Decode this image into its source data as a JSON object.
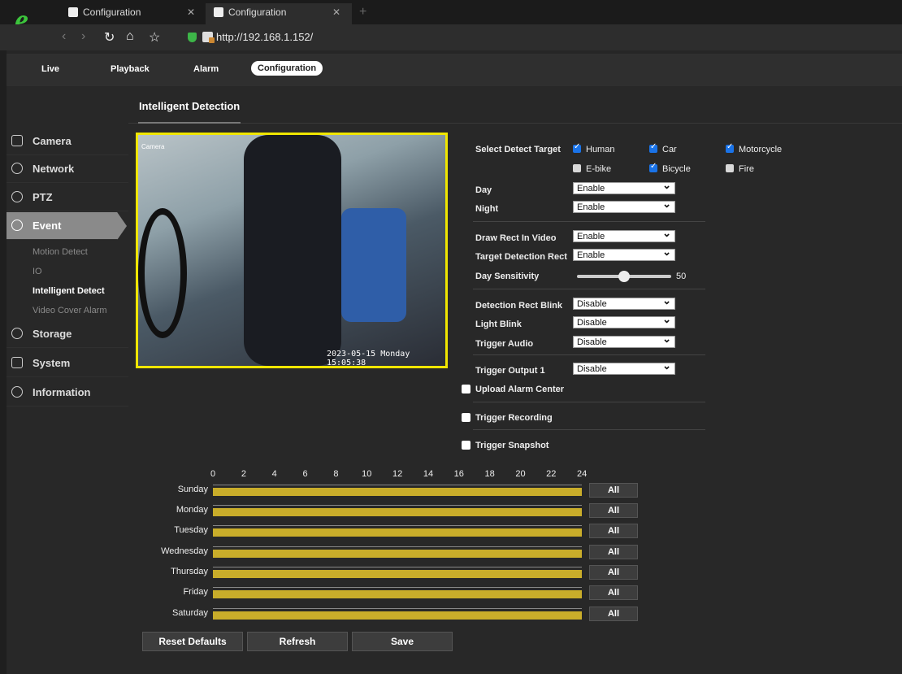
{
  "browser": {
    "tabs": [
      {
        "label": "Configuration"
      },
      {
        "label": "Configuration"
      }
    ],
    "url": "http://192.168.1.152/"
  },
  "topnav": {
    "items": [
      "Live",
      "Playback",
      "Alarm",
      "Configuration"
    ],
    "active": "Configuration"
  },
  "sidebar": {
    "items": [
      "Camera",
      "Network",
      "PTZ",
      "Event",
      "Storage",
      "System",
      "Information"
    ],
    "event_sub": [
      "Motion Detect",
      "IO",
      "Intelligent Detect",
      "Video Cover Alarm"
    ],
    "active_sub": "Intelligent Detect"
  },
  "page": {
    "title": "Intelligent Detection"
  },
  "video": {
    "camera_label": "Camera",
    "timestamp": "2023-05-15 Monday 15:05:38"
  },
  "form": {
    "detect_target_label": "Select Detect Target",
    "targets": [
      {
        "label": "Human",
        "checked": true
      },
      {
        "label": "Car",
        "checked": true
      },
      {
        "label": "Motorcycle",
        "checked": true
      },
      {
        "label": "E-bike",
        "checked": false
      },
      {
        "label": "Bicycle",
        "checked": true
      },
      {
        "label": "Fire",
        "checked": false
      }
    ],
    "day_label": "Day",
    "day_value": "Enable",
    "night_label": "Night",
    "night_value": "Enable",
    "draw_rect_label": "Draw Rect In Video",
    "draw_rect_value": "Enable",
    "target_rect_label": "Target Detection Rect",
    "target_rect_value": "Enable",
    "day_sensitivity_label": "Day Sensitivity",
    "day_sensitivity_value": "50",
    "rect_blink_label": "Detection Rect Blink",
    "rect_blink_value": "Disable",
    "light_blink_label": "Light Blink",
    "light_blink_value": "Disable",
    "trigger_audio_label": "Trigger Audio",
    "trigger_audio_value": "Disable",
    "trigger_output_label": "Trigger Output 1",
    "trigger_output_value": "Disable",
    "upload_alarm_label": "Upload Alarm Center",
    "trigger_recording_label": "Trigger Recording",
    "trigger_snapshot_label": "Trigger Snapshot"
  },
  "schedule": {
    "hours": [
      "0",
      "2",
      "4",
      "6",
      "8",
      "10",
      "12",
      "14",
      "16",
      "18",
      "20",
      "22",
      "24"
    ],
    "days": [
      "Sunday",
      "Monday",
      "Tuesday",
      "Wednesday",
      "Thursday",
      "Friday",
      "Saturday"
    ],
    "all_label": "All",
    "bar_color": "#c9ad2a"
  },
  "buttons": {
    "reset": "Reset Defaults",
    "refresh": "Refresh",
    "save": "Save"
  }
}
